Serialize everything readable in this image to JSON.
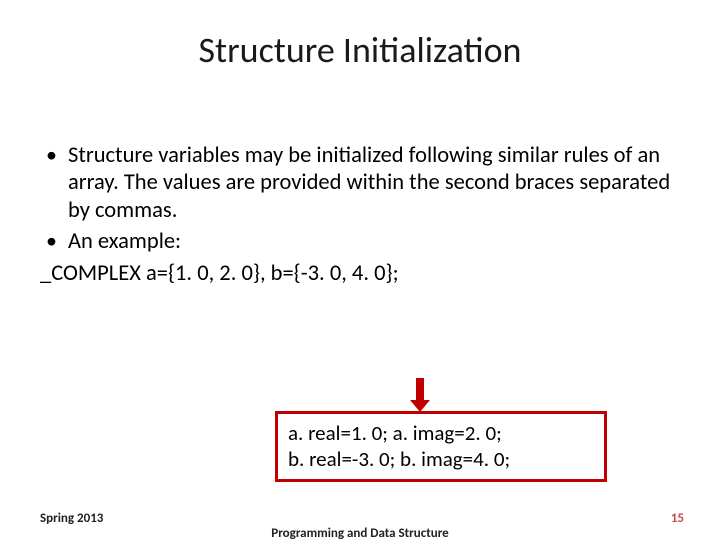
{
  "title": "Structure Initialization",
  "bullets": {
    "b1": "Structure variables may be initialized following similar rules of an array. The values are provided within the second braces separated by commas.",
    "b2": "An example:"
  },
  "code_line": "_COMPLEX a={1. 0, 2. 0}, b={-3. 0, 4. 0};",
  "box": {
    "line1": "a. real=1. 0; a. imag=2. 0;",
    "line2": "b. real=-3. 0; b. imag=4. 0;"
  },
  "footer": {
    "left": "Spring 2013",
    "center": "Programming and Data Structure",
    "right": "15"
  }
}
